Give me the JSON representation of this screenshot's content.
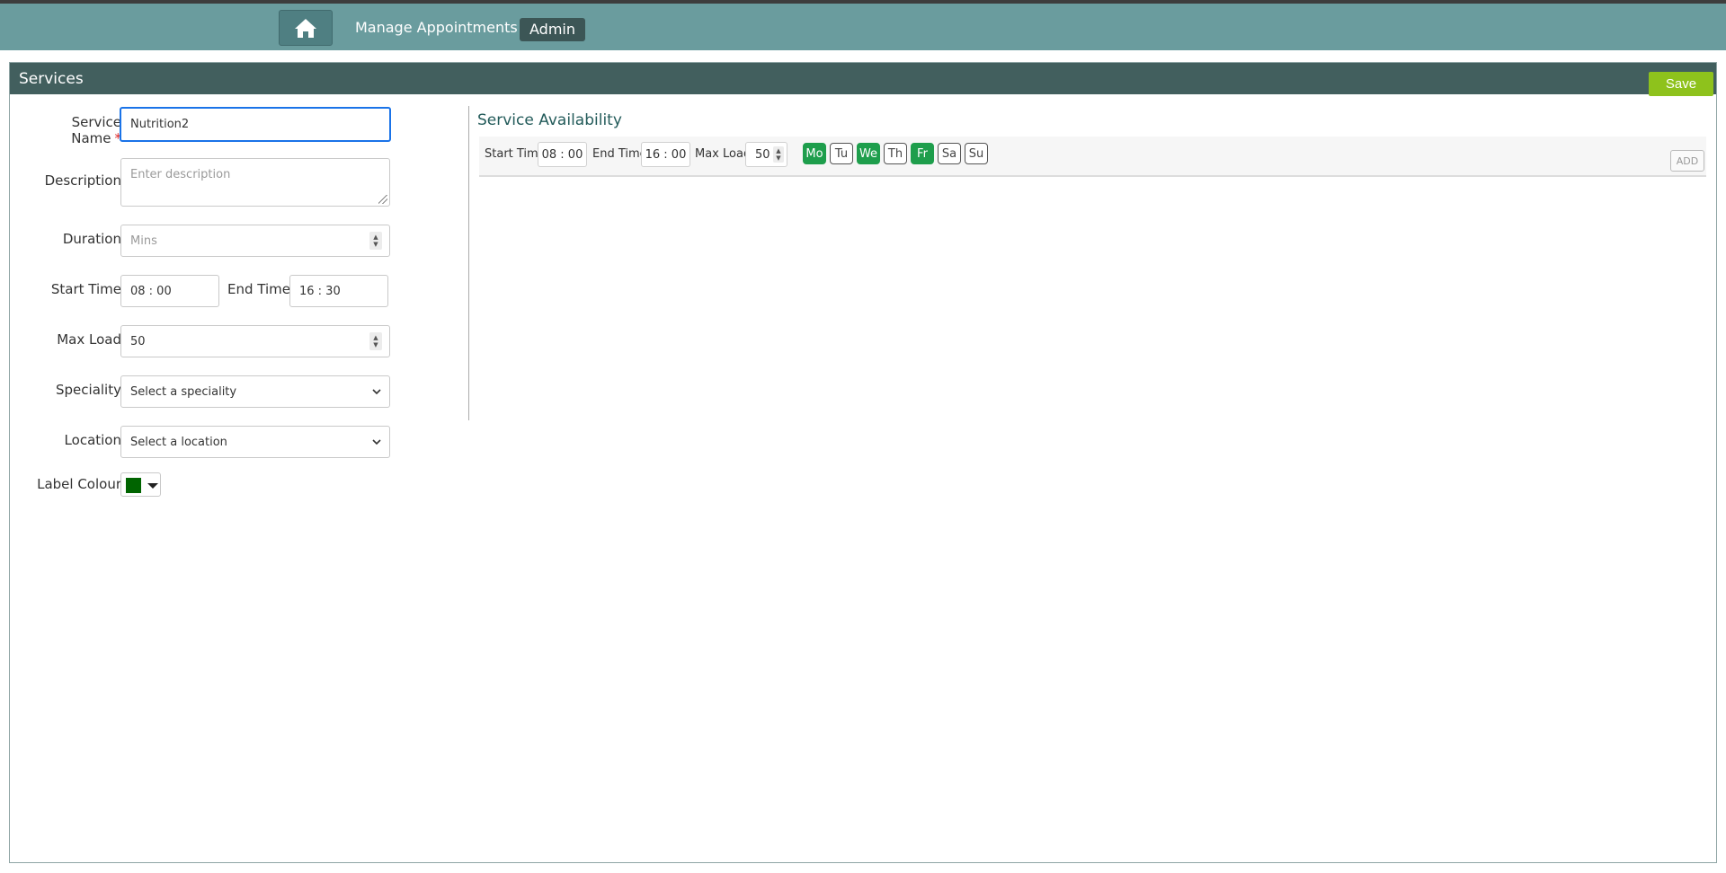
{
  "nav": {
    "home_icon": "home-icon",
    "manage_appointments": "Manage Appointments",
    "admin": "Admin"
  },
  "panel": {
    "title": "Services",
    "save_label": "Save"
  },
  "form": {
    "service_name": {
      "label": "Service Name",
      "required_mark": "*",
      "value": "Nutrition2"
    },
    "description": {
      "label": "Description",
      "placeholder": "Enter description"
    },
    "duration": {
      "label": "Duration",
      "placeholder": "Mins"
    },
    "start_time": {
      "label": "Start Time",
      "value": "08 : 00"
    },
    "end_time": {
      "label": "End Time",
      "value": "16 : 30"
    },
    "max_load": {
      "label": "Max Load",
      "value": "50"
    },
    "speciality": {
      "label": "Speciality",
      "value": "Select a speciality"
    },
    "location": {
      "label": "Location",
      "value": "Select a location"
    },
    "label_colour": {
      "label": "Label Colour",
      "color": "#006400"
    }
  },
  "availability": {
    "title": "Service Availability",
    "start_label": "Start Time",
    "start_value": "08 : 00",
    "end_label": "End Time",
    "end_value": "16 : 00",
    "max_load_label": "Max Load",
    "max_load_value": "50",
    "days": [
      {
        "label": "Mo",
        "active": true
      },
      {
        "label": "Tu",
        "active": false
      },
      {
        "label": "We",
        "active": true
      },
      {
        "label": "Th",
        "active": false
      },
      {
        "label": "Fr",
        "active": true
      },
      {
        "label": "Sa",
        "active": false
      },
      {
        "label": "Su",
        "active": false
      }
    ],
    "add_label": "ADD"
  },
  "colors": {
    "navbar": "#6a9c9e",
    "panel_header": "#425f5e",
    "save": "#8ec21c",
    "day_active": "#1e9e4c"
  }
}
